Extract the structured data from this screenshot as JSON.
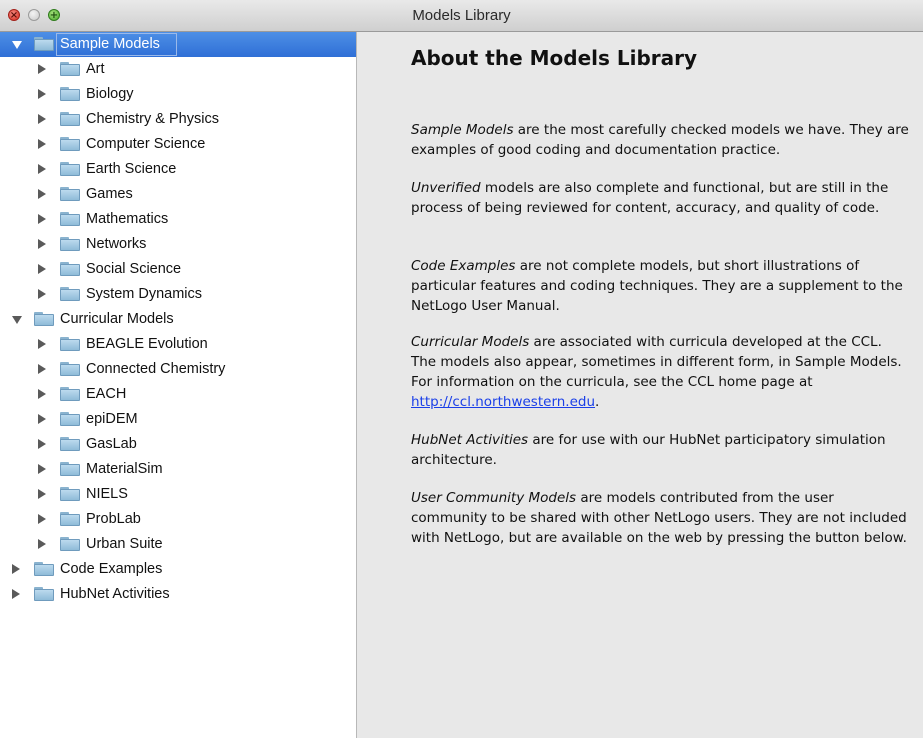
{
  "window": {
    "title": "Models Library"
  },
  "tree": {
    "sample": {
      "label": "Sample Models",
      "children": [
        "Art",
        "Biology",
        "Chemistry & Physics",
        "Computer Science",
        "Earth Science",
        "Games",
        "Mathematics",
        "Networks",
        "Social Science",
        "System Dynamics"
      ]
    },
    "curricular": {
      "label": "Curricular Models",
      "children": [
        "BEAGLE Evolution",
        "Connected Chemistry",
        "EACH",
        "epiDEM",
        "GasLab",
        "MaterialSim",
        "NIELS",
        "ProbLab",
        "Urban Suite"
      ]
    },
    "code": {
      "label": "Code Examples"
    },
    "hubnet": {
      "label": "HubNet Activities"
    }
  },
  "about": {
    "heading": "About the Models Library",
    "p1": {
      "em": "Sample Models",
      "rest": " are the most carefully checked models we have. They are examples of good coding and documentation practice."
    },
    "p2": {
      "em": "Unverified",
      "rest": " models are also complete and functional, but are still in the process of being reviewed for content, accuracy, and quality of code."
    },
    "p3": {
      "em": "Code Examples",
      "rest": " are not complete models, but short illustrations of particular features and coding techniques. They are a supplement to the NetLogo User Manual."
    },
    "p4": {
      "em": "Curricular Models",
      "rest": " are associated with curricula developed at the CCL. The models also appear, sometimes in different form, in Sample Models. For information on the curricula, see the CCL home page at ",
      "link": "http://ccl.northwestern.edu",
      "end": "."
    },
    "p5": {
      "em": "HubNet Activities",
      "rest": " are for use with our HubNet participatory simulation architecture."
    },
    "p6": {
      "em": "User Community Models",
      "rest": " are models contributed from the user community to be shared with other NetLogo users. They are not included with NetLogo, but are available on the web by pressing the button below."
    }
  },
  "colors": {
    "selection": "#3a7ee0",
    "link": "#1a3fe8"
  }
}
